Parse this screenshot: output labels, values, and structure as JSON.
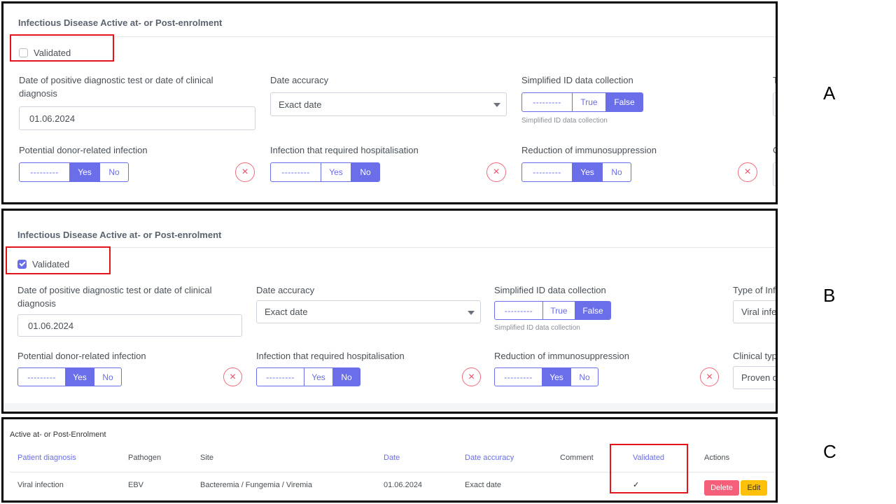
{
  "section_title": "Infectious Disease Active at- or Post-enrolment",
  "validated_label": "Validated",
  "fields": {
    "diag_date_label": "Date of positive diagnostic test or date of clinical diagnosis",
    "diag_date_value": "01.06.2024",
    "date_accuracy_label": "Date accuracy",
    "date_accuracy_value": "Exact date",
    "simplified_label": "Simplified ID data collection",
    "simplified_help": "Simplified ID data collection",
    "type_label_b": "Type of Infe",
    "type_value_b": "Viral infec",
    "type_label_a": "T",
    "donor_label": "Potential donor-related infection",
    "hosp_label": "Infection that required hospitalisation",
    "immuno_label": "Reduction of immunosuppression",
    "clinical_label_b": "Clinical type",
    "clinical_value_b": "Proven di",
    "clinical_label_a": "C"
  },
  "toggles": {
    "blank": "---------",
    "true": "True",
    "false": "False",
    "yes": "Yes",
    "no": "No"
  },
  "clear_symbol": "×",
  "panels": {
    "A": {
      "letter": "A",
      "validated": false
    },
    "B": {
      "letter": "B",
      "validated": true
    },
    "C": {
      "letter": "C"
    }
  },
  "table": {
    "title": "Active at- or Post-Enrolment",
    "headers": [
      "Patient diagnosis",
      "Pathogen",
      "Site",
      "Date",
      "Date accuracy",
      "Comment",
      "Validated",
      "Actions"
    ],
    "row": {
      "diagnosis": "Viral infection",
      "pathogen": "EBV",
      "site": "Bacteremia / Fungemia / Viremia",
      "date": "01.06.2024",
      "accuracy": "Exact date",
      "comment": "",
      "validated": "✓"
    },
    "delete_label": "Delete",
    "edit_label": "Edit"
  },
  "colors": {
    "accent": "#6a6ee8",
    "highlight_box": "#e3141b",
    "danger": "#f65f7a",
    "warning": "#ffc107"
  }
}
